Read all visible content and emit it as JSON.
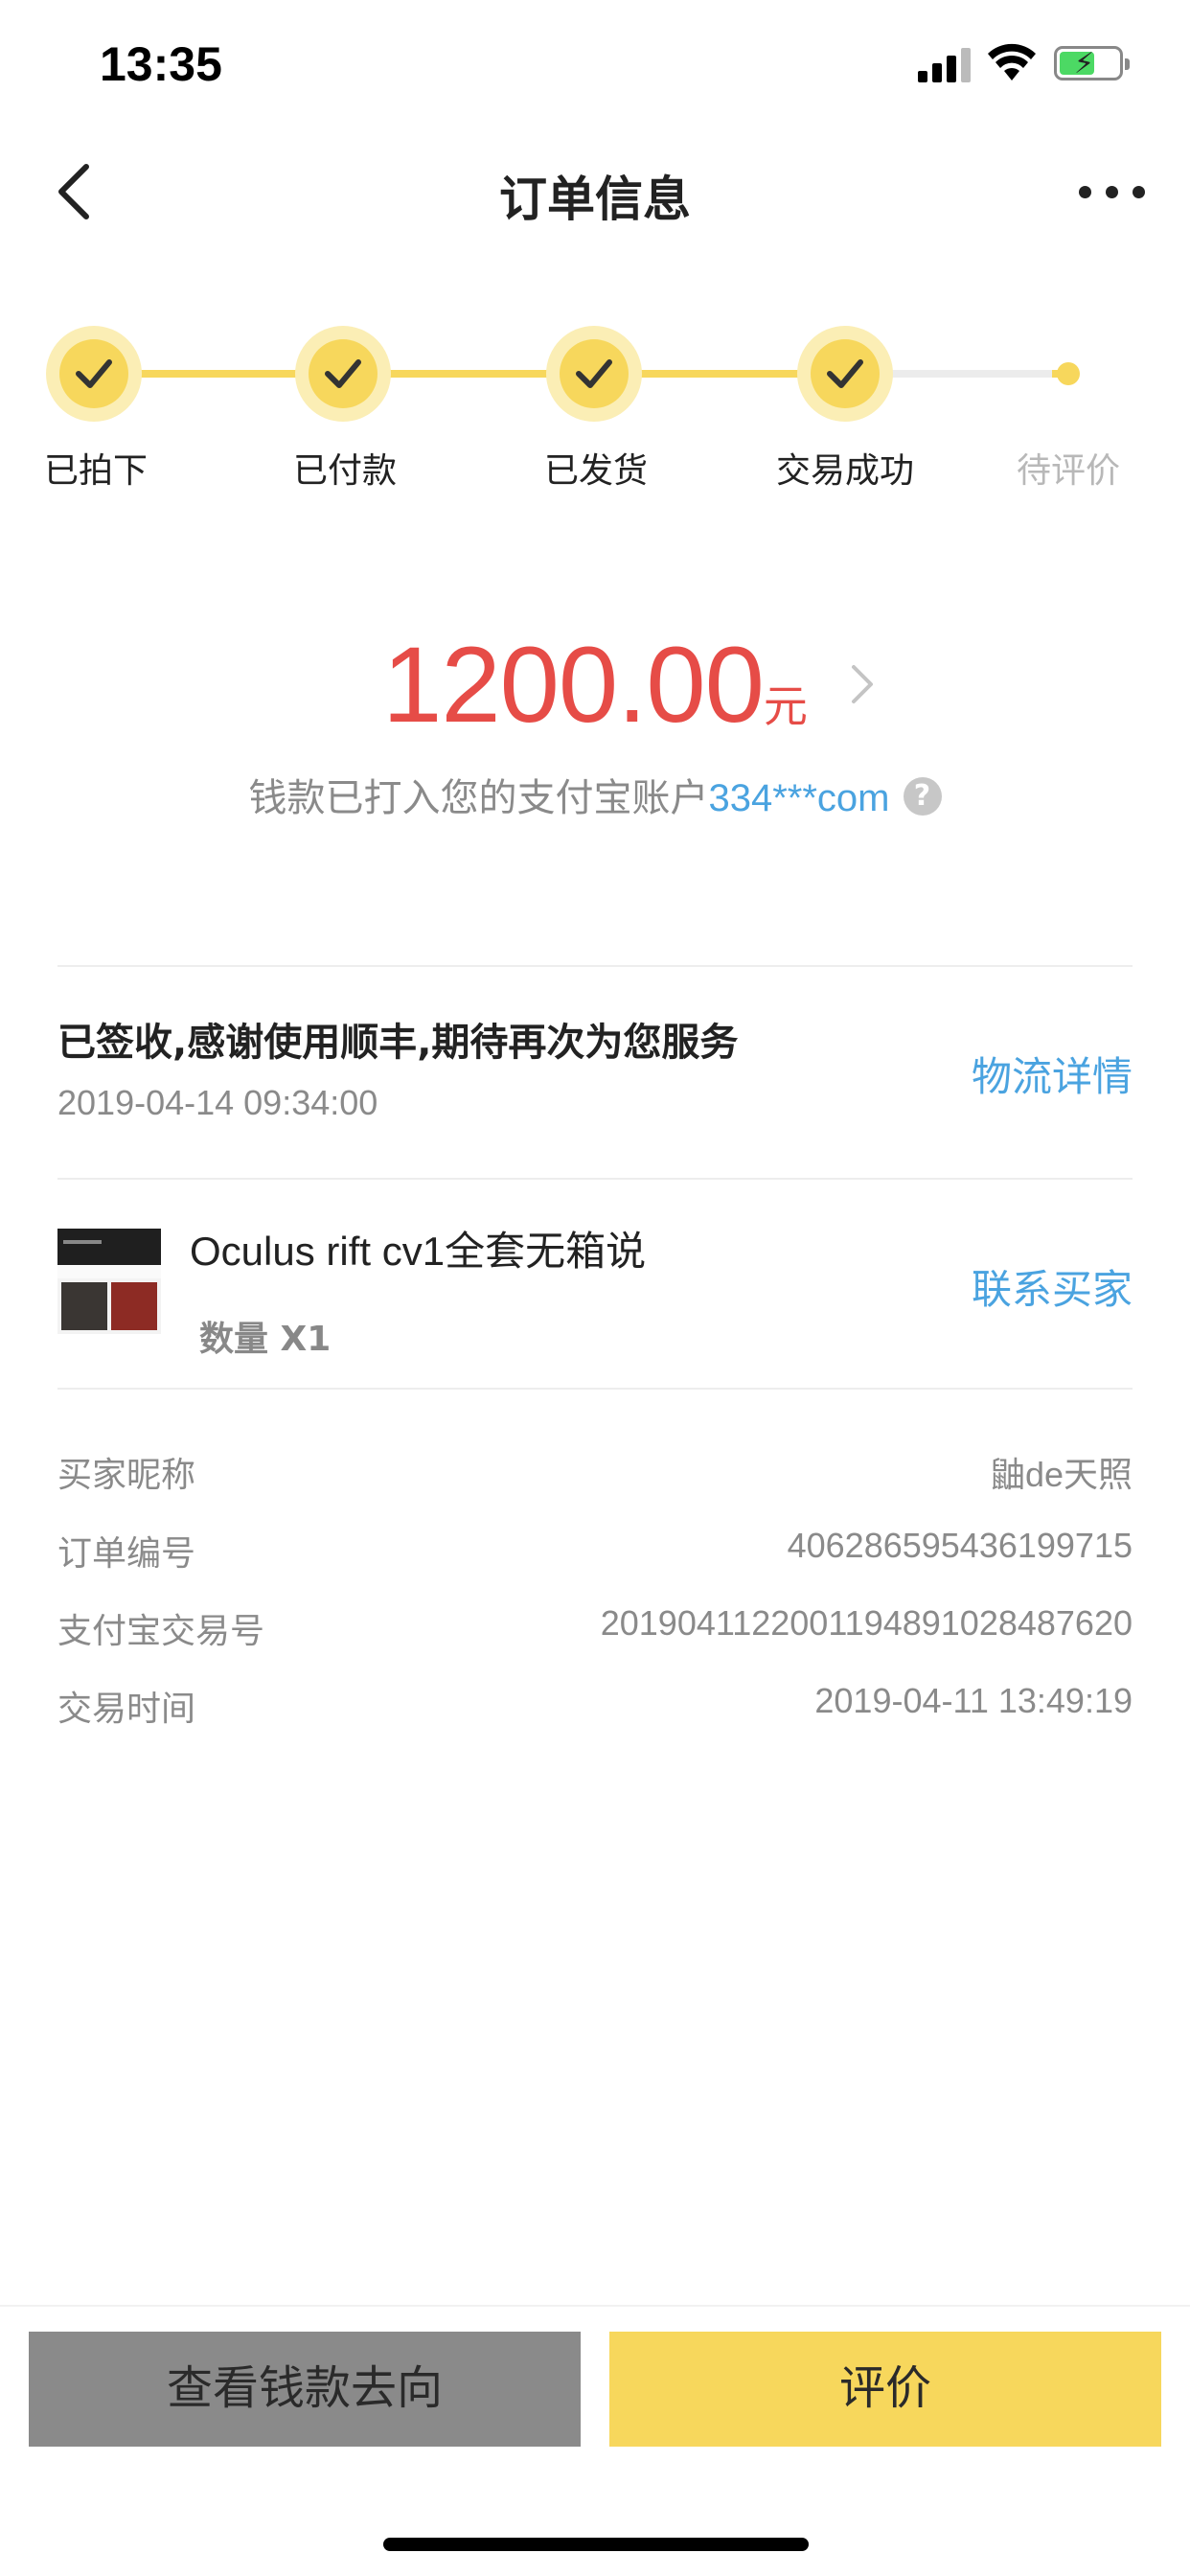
{
  "status_bar": {
    "time": "13:35"
  },
  "nav": {
    "title": "订单信息"
  },
  "steps": [
    {
      "label": "已拍下",
      "state": "done"
    },
    {
      "label": "已付款",
      "state": "done"
    },
    {
      "label": "已发货",
      "state": "done"
    },
    {
      "label": "交易成功",
      "state": "done"
    },
    {
      "label": "待评价",
      "state": "pending"
    }
  ],
  "amount": {
    "value": "1200.00",
    "unit": "元"
  },
  "deposit": {
    "text": "钱款已打入您的支付宝账户",
    "account": "334***com",
    "help": "?"
  },
  "logistics": {
    "status": "已签收,感谢使用顺丰,期待再次为您服务",
    "time": "2019-04-14 09:34:00",
    "link": "物流详情"
  },
  "product": {
    "title": "Oculus rift cv1全套无箱说",
    "quantity": "数量 X1",
    "contact": "联系买家"
  },
  "info": [
    {
      "key": "买家昵称",
      "value": "鼬de天照"
    },
    {
      "key": "订单编号",
      "value": "406286595436199715"
    },
    {
      "key": "支付宝交易号",
      "value": "2019041122001194891028487620"
    },
    {
      "key": "交易时间",
      "value": "2019-04-11 13:49:19"
    }
  ],
  "actions": {
    "view_funds": "查看钱款去向",
    "review": "评价"
  },
  "colors": {
    "accent_yellow": "#f7d75c",
    "price_red": "#e64c47",
    "link_blue": "#4aa3e0"
  }
}
